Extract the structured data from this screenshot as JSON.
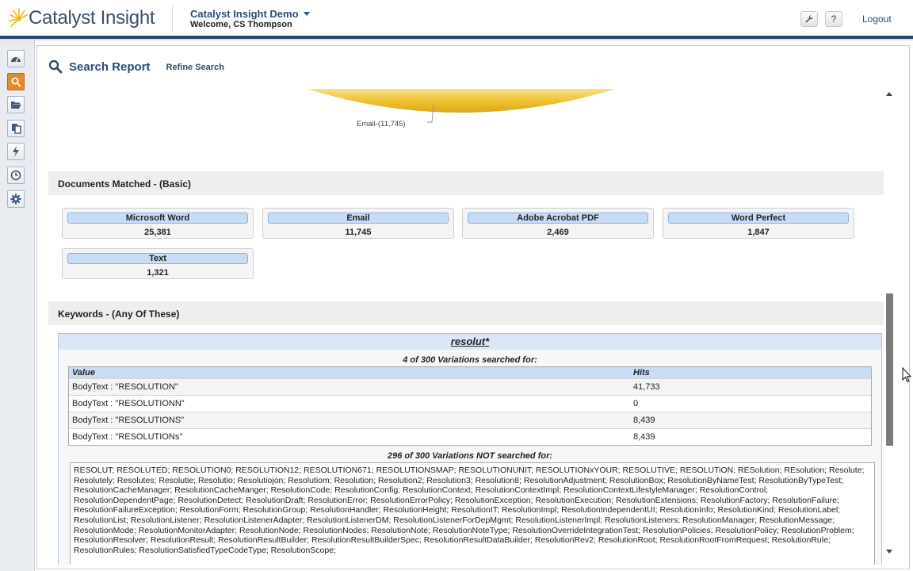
{
  "header": {
    "logo_text": "Catalyst Insight",
    "app_title": "Catalyst Insight Demo",
    "welcome": "Welcome, CS Thompson",
    "tools_icon": "wrench-icon",
    "help_label": "?",
    "logout_label": "Logout",
    "accent_color": "#2b4a6b"
  },
  "rail": {
    "items": [
      {
        "icon": "dashboard-icon"
      },
      {
        "icon": "search-icon",
        "active": true
      },
      {
        "icon": "folder-open-icon"
      },
      {
        "icon": "copy-documents-icon"
      },
      {
        "icon": "lightning-icon"
      },
      {
        "icon": "clock-icon"
      },
      {
        "icon": "gear-icon"
      }
    ]
  },
  "page": {
    "title": "Search Report",
    "refine_label": "Refine Search",
    "pie_label": "Email-(11,745)"
  },
  "documents": {
    "heading": "Documents Matched - (Basic)",
    "cards": [
      {
        "label": "Microsoft Word",
        "value": "25,381"
      },
      {
        "label": "Email",
        "value": "11,745"
      },
      {
        "label": "Adobe Acrobat PDF",
        "value": "2,469"
      },
      {
        "label": "Word Perfect",
        "value": "1,847"
      },
      {
        "label": "Text",
        "value": "1,321"
      }
    ]
  },
  "keywords": {
    "heading": "Keywords - (Any Of These)",
    "term": "resolut*",
    "searched_caption": "4 of 300 Variations searched for:",
    "columns": {
      "value": "Value",
      "hits": "Hits"
    },
    "rows": [
      {
        "value": "BodyText : \"RESOLUTION\"",
        "hits": "41,733"
      },
      {
        "value": "BodyText : \"RESOLUTIONN\"",
        "hits": "0"
      },
      {
        "value": "BodyText : \"RESOLUTIONS\"",
        "hits": "8,439"
      },
      {
        "value": "BodyText : \"RESOLUTIONs\"",
        "hits": "8,439"
      }
    ],
    "not_searched_caption": "296 of 300 Variations NOT searched for:",
    "not_searched_text": "RESOLUT; RESOLUTED; RESOLUTION0; RESOLUTION12; RESOLUTION671; RESOLUTIONSMAP; RESOLUTIONUNIT; RESOLUTIONxYOUR; RESOLUTIVE; RESOLUTiON; RESolution; REsolution; Resolute; Resolutely; Resolutes; Resolutie; Resolutio; Resolutiojon; Resolutiom; Resolution; Resolution2; Resolution3; Resolution8; ResolutionAdjustment; ResolutionBox; ResolutionByNameTest; ResolutionByTypeTest; ResolutionCacheManager; ResolutionCacheManger; ResolutionCode; ResolutionConfig; ResolutionContext; ResolutionContextImpl; ResolutionContextLifestyleManager; ResolutionControl; ResolutionDependentPage; ResolutionDetect; ResolutionDraft; ResolutionError; ResolutionErrorPolicy; ResolutionException; ResolutionExecution; ResolutionExtensions; ResolutionFactory; ResolutionFailure; ResolutionFailureException; ResolutionForm; ResolutionGroup; ResolutionHandler; ResolutionHeight; ResolutionIT; ResolutionImpl; ResolutionIndependentUI; ResolutionInfo; ResolutionKind; ResolutionLabel; ResolutionList; ResolutionListener; ResolutionListenerAdapter; ResolutionListenerDM; ResolutionListenerForDepMgmt; ResolutionListenerImpl; ResolutionListeners; ResolutionManager; ResolutionMessage; ResolutionMode; ResolutionMonitorAdapter; ResolutionNode; ResolutionNodes; ResolutionNote; ResolutionNoteType; ResolutionOverrideIntegrationTest; ResolutionPolicies; ResolutionPolicy; ResolutionProblem; ResolutionResolver; ResolutionResult; ResolutionResultBuilder; ResolutionResultBuilderSpec; ResolutionResultDataBuilder; ResolutionRev2; ResolutionRoot; ResolutionRootFromRequest; ResolutionRule; ResolutionRules; ResolutionSatisfiedTypeCodeType; ResolutionScope;"
  }
}
